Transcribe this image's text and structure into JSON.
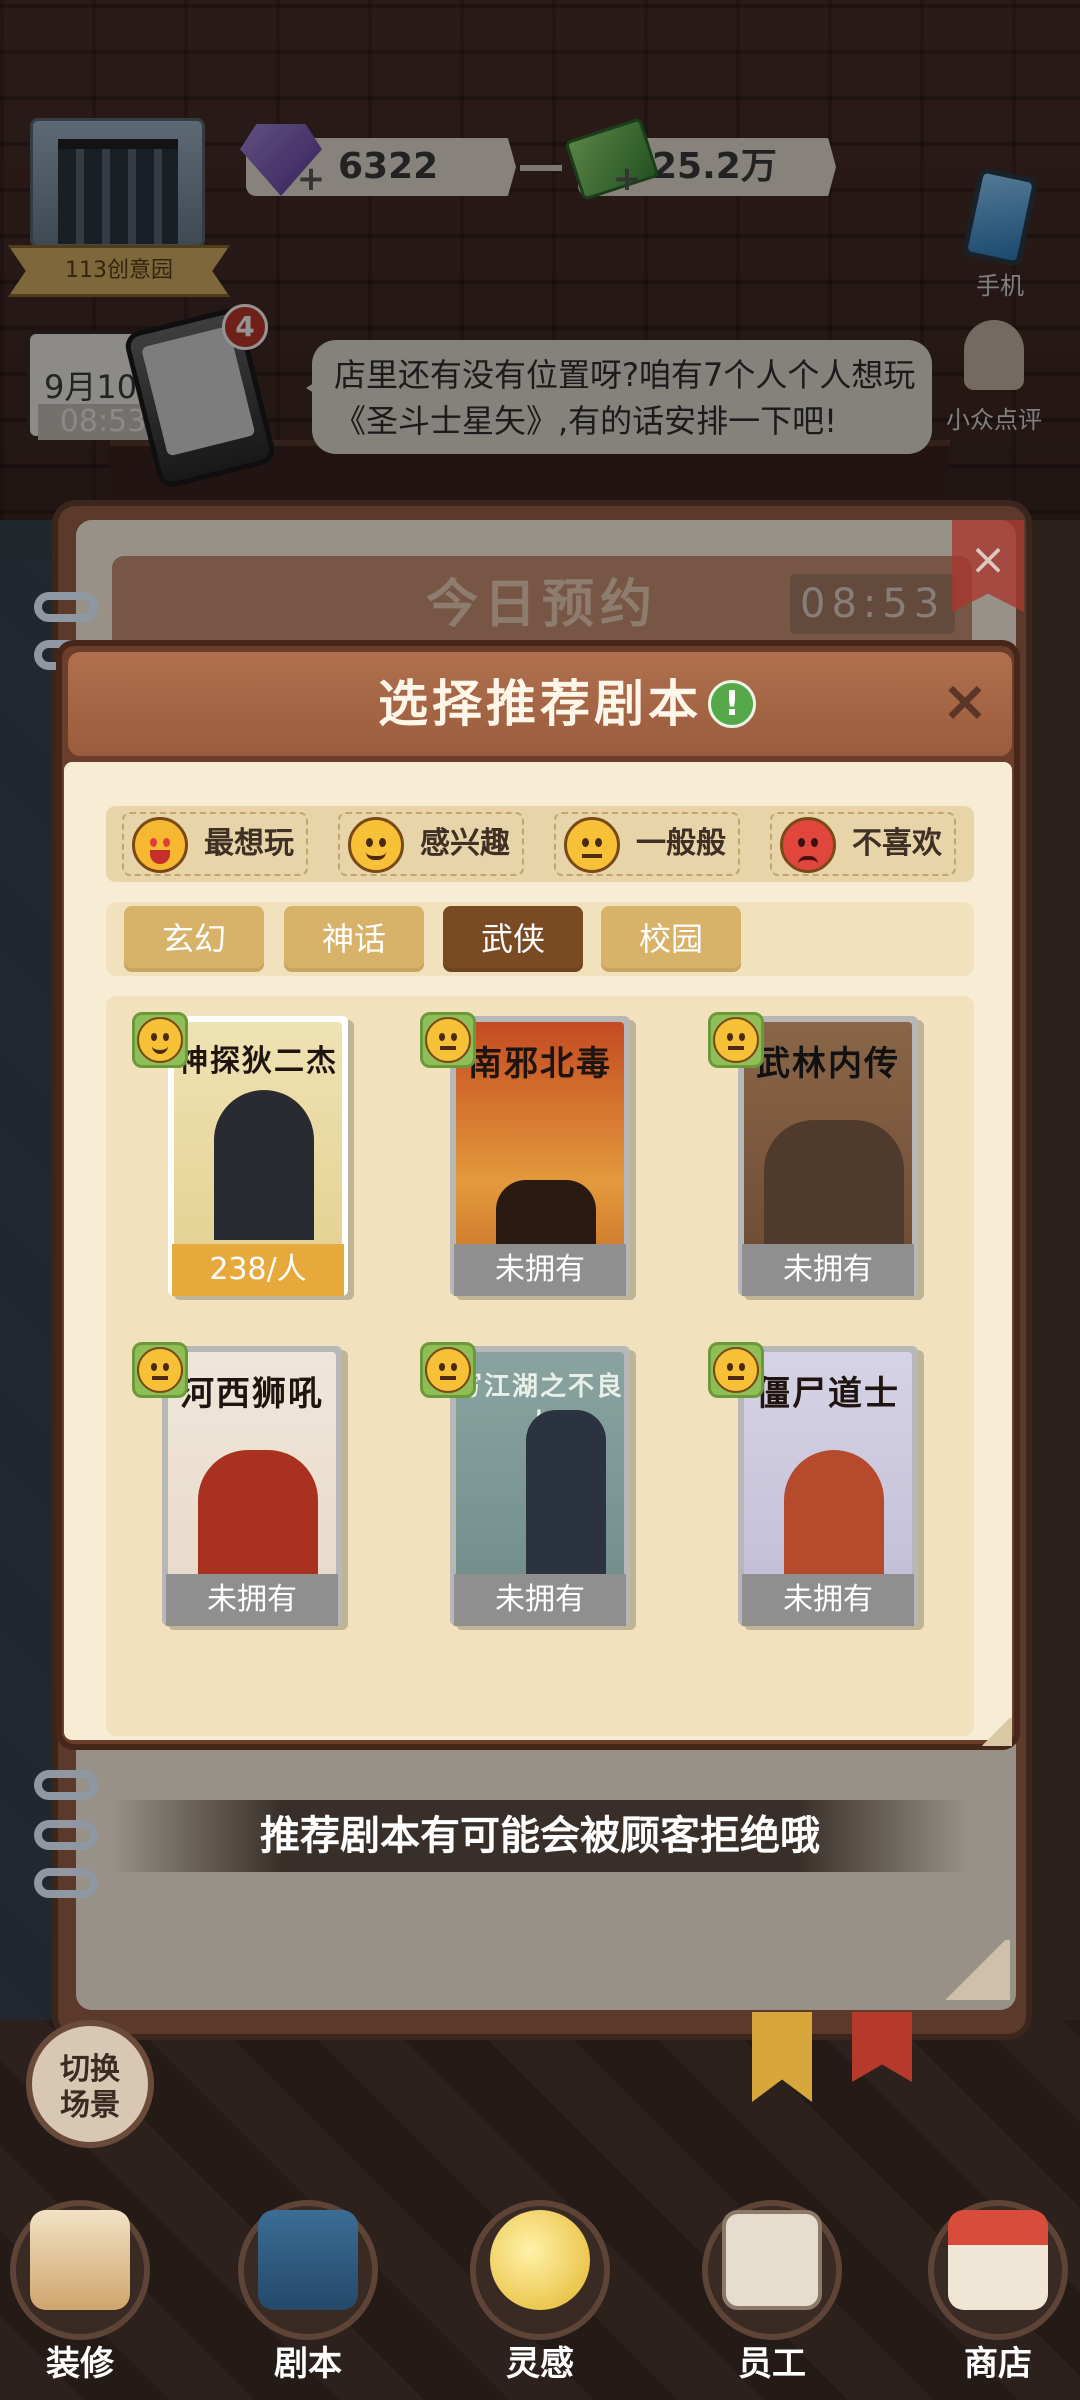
{
  "hud": {
    "park_name": "113创意园",
    "gems": "6322",
    "money": "25.2万",
    "plus": "+",
    "phone_label": "手机",
    "review_label": "小众点评",
    "date": "9月10",
    "clock": "08:53",
    "call_badge": "4"
  },
  "speech": {
    "line1": "店里还有没有位置呀?咱有7个人个人想玩",
    "line2": "《圣斗士星矢》,有的话安排一下吧!"
  },
  "appointment": {
    "title": "今日预约",
    "time": "08:53",
    "close": "×"
  },
  "dialog": {
    "title": "选择推荐剧本",
    "info": "!",
    "close": "×",
    "legend": [
      {
        "label": "最想玩",
        "mood": "love"
      },
      {
        "label": "感兴趣",
        "mood": "like"
      },
      {
        "label": "一般般",
        "mood": "meh"
      },
      {
        "label": "不喜欢",
        "mood": "angry"
      }
    ],
    "tabs": [
      {
        "label": "玄幻",
        "active": false
      },
      {
        "label": "神话",
        "active": false
      },
      {
        "label": "武侠",
        "active": true
      },
      {
        "label": "校园",
        "active": false
      }
    ],
    "scripts": [
      {
        "title": "神探狄二杰",
        "status": "238/人",
        "owned": true,
        "mood": "like"
      },
      {
        "title": "南邪北毒",
        "status": "未拥有",
        "owned": false,
        "mood": "meh"
      },
      {
        "title": "武林内传",
        "status": "未拥有",
        "owned": false,
        "mood": "meh"
      },
      {
        "title": "河西狮吼",
        "status": "未拥有",
        "owned": false,
        "mood": "meh"
      },
      {
        "title": "写江湖之不良人",
        "status": "未拥有",
        "owned": false,
        "mood": "meh"
      },
      {
        "title": "僵尸道士",
        "status": "未拥有",
        "owned": false,
        "mood": "meh"
      }
    ],
    "hint": "推荐剧本有可能会被顾客拒绝哦"
  },
  "switch_scene": {
    "line1": "切换",
    "line2": "场景"
  },
  "nav": [
    {
      "label": "装修",
      "icon": "decorate-icon"
    },
    {
      "label": "剧本",
      "icon": "script-book-icon"
    },
    {
      "label": "灵感",
      "icon": "inspiration-bulb-icon"
    },
    {
      "label": "员工",
      "icon": "staff-badge-icon"
    },
    {
      "label": "商店",
      "icon": "shop-icon"
    }
  ],
  "colors": {
    "header_brown": "#a86748",
    "active_tab": "#7a4a23",
    "tab": "#d9b26a",
    "owned_price": "#e7a93b",
    "not_owned": "#8f8f8f",
    "body_cream": "#f7ecd4"
  }
}
